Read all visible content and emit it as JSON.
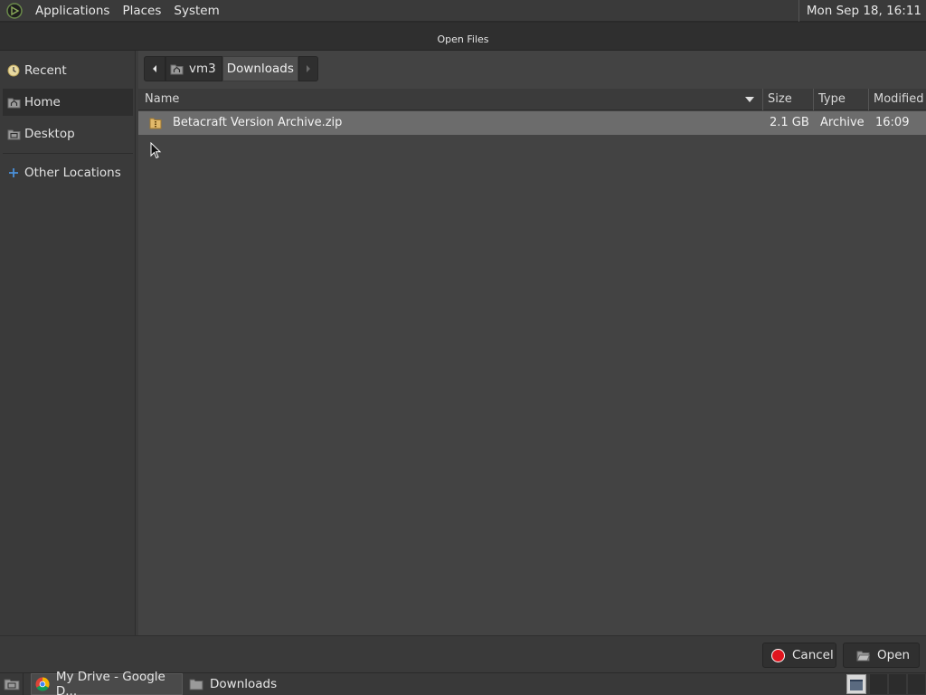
{
  "top_panel": {
    "menus": [
      "Applications",
      "Places",
      "System"
    ],
    "clock": "Mon Sep 18, 16:11"
  },
  "dialog": {
    "title": "Open Files",
    "sidebar": {
      "items": [
        {
          "label": "Recent",
          "icon": "recent-icon"
        },
        {
          "label": "Home",
          "icon": "home-folder-icon"
        },
        {
          "label": "Desktop",
          "icon": "desktop-folder-icon"
        },
        {
          "label": "Other Locations",
          "icon": "plus-icon"
        }
      ],
      "active": "Home"
    },
    "pathbar": {
      "segments": [
        "vm3",
        "Downloads"
      ],
      "current": "Downloads"
    },
    "columns": {
      "name": "Name",
      "size": "Size",
      "type": "Type",
      "modified": "Modified"
    },
    "files": [
      {
        "name": "Betacraft Version Archive.zip",
        "size": "2.1 GB",
        "type": "Archive",
        "modified": "16:09",
        "icon": "archive-icon"
      }
    ],
    "buttons": {
      "cancel": "Cancel",
      "open": "Open"
    },
    "colors": {
      "background": "#434343",
      "selected_row": "#6c6c6c",
      "cancel_icon": "#e0141e"
    }
  },
  "taskbar": {
    "tasks": [
      {
        "label": "My Drive - Google D...",
        "icon": "chrome-icon"
      },
      {
        "label": "Downloads",
        "icon": "folder-icon"
      }
    ]
  }
}
